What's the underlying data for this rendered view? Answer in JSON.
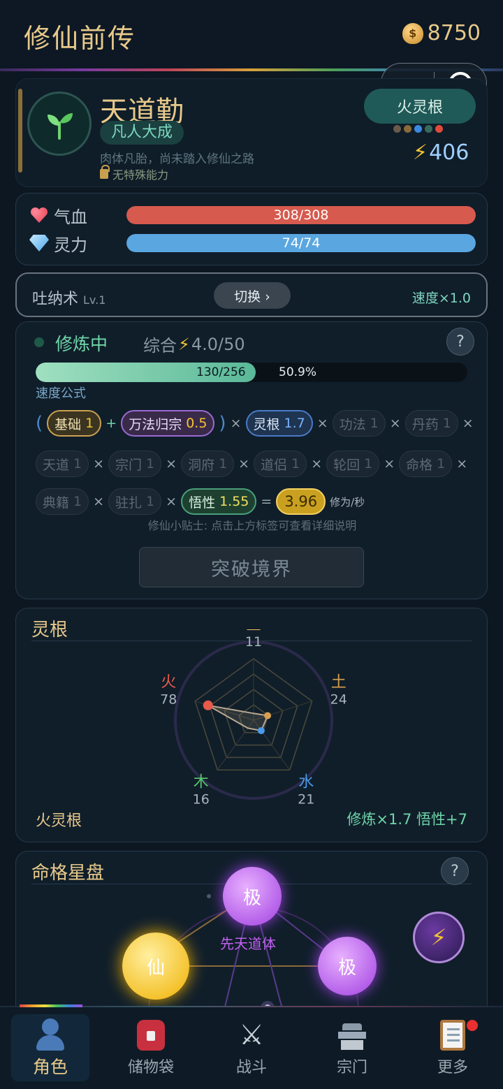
{
  "header": {
    "title": "修仙前传",
    "coin_icon": "money-bag-icon",
    "coins": "8750"
  },
  "capsule": {
    "more_icon": "more-dots-icon",
    "close_icon": "close-target-icon"
  },
  "profile": {
    "avatar_icon": "sprout-icon",
    "name": "天道勤",
    "realm": "凡人大成",
    "description": "肉体凡胎，尚未踏入修仙之路",
    "ability": "无特殊能力",
    "root_label": "火灵根",
    "root_dot_colors": [
      "#6a5a4a",
      "#8a6a3a",
      "#3a8ae0",
      "#3a6a5a",
      "#e04a3a"
    ],
    "power": "406"
  },
  "stats": {
    "hp": {
      "label": "气血",
      "text": "308/308",
      "fraction": 1.0,
      "color": "#d65a4e"
    },
    "mp": {
      "label": "灵力",
      "text": "74/74",
      "fraction": 1.0,
      "color": "#5aa6e0"
    }
  },
  "technique": {
    "name": "吐纳术",
    "level": "Lv.1",
    "switch_label": "切换 ›",
    "speed": "速度×1.0"
  },
  "cultivation": {
    "status": "修炼中",
    "overall_label": "综合",
    "overall_value": "4.0/50",
    "help": "?",
    "progress_count": "130/256",
    "progress_percent": "50.9%",
    "progress_fraction": 0.509,
    "formula_label": "速度公式",
    "factors": {
      "base": {
        "name": "基础",
        "value": "1"
      },
      "wanfa": {
        "name": "万法归宗",
        "value": "0.5"
      },
      "root": {
        "name": "灵根",
        "value": "1.7"
      },
      "method": {
        "name": "功法",
        "value": "1"
      },
      "pill": {
        "name": "丹药",
        "value": "1"
      },
      "heaven": {
        "name": "天道",
        "value": "1"
      },
      "sect": {
        "name": "宗门",
        "value": "1"
      },
      "cave": {
        "name": "洞府",
        "value": "1"
      },
      "partner": {
        "name": "道侣",
        "value": "1"
      },
      "reincarnation": {
        "name": "轮回",
        "value": "1"
      },
      "fate": {
        "name": "命格",
        "value": "1"
      },
      "book": {
        "name": "典籍",
        "value": "1"
      },
      "station": {
        "name": "驻扎",
        "value": "1"
      },
      "insight": {
        "name": "悟性",
        "value": "1.55"
      }
    },
    "result": "3.96",
    "result_unit": "修为/秒",
    "tip": "修仙小贴士: 点击上方标签可查看详细说明",
    "breakthrough_label": "突破境界"
  },
  "spirit_root": {
    "title": "灵根",
    "elements": [
      {
        "name": "金",
        "value": 11,
        "color": "#f0c060"
      },
      {
        "name": "土",
        "value": 24,
        "color": "#d8a050"
      },
      {
        "name": "水",
        "value": 21,
        "color": "#4a9ae8"
      },
      {
        "name": "木",
        "value": 16,
        "color": "#5ac870"
      },
      {
        "name": "火",
        "value": 78,
        "color": "#e85a4a"
      }
    ],
    "root_name": "火灵根",
    "bonus": "修炼×1.7  悟性+7"
  },
  "destiny": {
    "title": "命格星盘",
    "help": "?",
    "orbs": {
      "top": "极",
      "left": "仙",
      "right": "极"
    },
    "trait": "先天道体",
    "boost_icon": "lightning-icon"
  },
  "nav": [
    {
      "label": "角色",
      "icon": "user-icon"
    },
    {
      "label": "储物袋",
      "icon": "backpack-icon"
    },
    {
      "label": "战斗",
      "icon": "crossed-swords-icon"
    },
    {
      "label": "宗门",
      "icon": "castle-icon"
    },
    {
      "label": "更多",
      "icon": "clipboard-icon"
    }
  ]
}
